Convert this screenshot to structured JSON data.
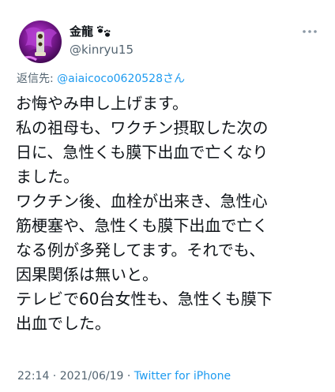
{
  "author": {
    "display_name": "金龍",
    "handle": "@kinryu15"
  },
  "reply": {
    "prefix": "返信先: ",
    "mention": "@aiaicoco0620528さん"
  },
  "tweet": {
    "lines": [
      "お悔やみ申し上げます。",
      "私の祖母も、ワクチン摂取した次の",
      "日に、急性くも膜下出血で亡くなり",
      "ました。",
      "ワクチン後、血栓が出来き、急性心",
      "筋梗塞や、急性くも膜下出血で亡く",
      "なる例が多発してます。それでも、",
      "因果関係は無いと。",
      "テレビで60台女性も、急性くも膜下",
      "出血でした。"
    ]
  },
  "meta": {
    "time": "22:14",
    "separator1": " · ",
    "date": "2021/06/19",
    "separator2": " · ",
    "source": "Twitter for iPhone"
  },
  "colors": {
    "text": "#0f1419",
    "secondary": "#536471",
    "link": "#1d9bf0"
  }
}
